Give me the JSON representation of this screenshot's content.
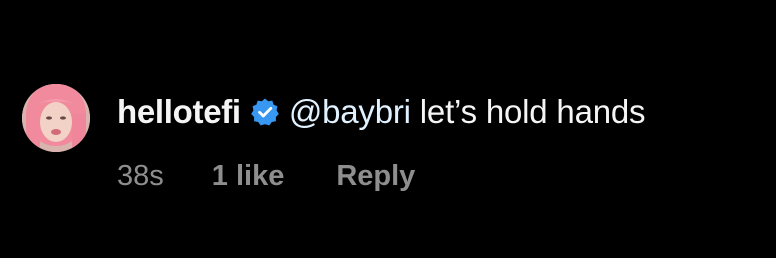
{
  "comment": {
    "avatar_icon": "profile-photo",
    "username": "hellotefi",
    "verified_icon": "verified-badge-icon",
    "verified_color": "#3897f0",
    "mention": "@baybri",
    "text": "let’s hold hands",
    "timestamp": "38s",
    "likes": "1 like",
    "reply_label": "Reply"
  },
  "colors": {
    "background": "#000000",
    "primary_text": "#f5f5f5",
    "mention_text": "#e0f1ff",
    "secondary_text": "#8e8e8e"
  }
}
